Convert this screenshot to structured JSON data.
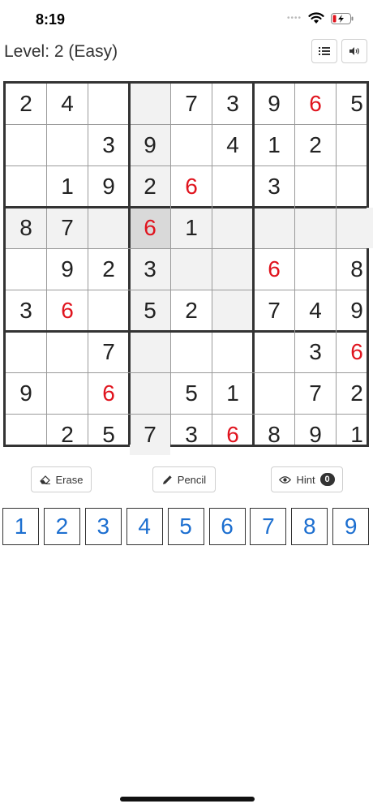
{
  "status_bar": {
    "time": "8:19"
  },
  "header": {
    "level_text": "Level: 2 (Easy)"
  },
  "board": {
    "rows": [
      [
        "2",
        "4",
        "",
        "",
        "7",
        "3",
        "9",
        "6",
        "5"
      ],
      [
        "",
        "",
        "3",
        "9",
        "",
        "4",
        "1",
        "2",
        ""
      ],
      [
        "",
        "1",
        "9",
        "2",
        "6",
        "",
        "3",
        "",
        ""
      ],
      [
        "8",
        "7",
        "",
        "6",
        "1",
        "",
        "",
        "",
        ""
      ],
      [
        "",
        "9",
        "2",
        "3",
        "",
        "",
        "6",
        "",
        "8"
      ],
      [
        "3",
        "6",
        "",
        "5",
        "2",
        "",
        "7",
        "4",
        "9"
      ],
      [
        "",
        "",
        "7",
        "",
        "",
        "",
        "",
        "3",
        "6"
      ],
      [
        "9",
        "",
        "6",
        "",
        "5",
        "1",
        "",
        "7",
        "2"
      ],
      [
        "",
        "2",
        "5",
        "7",
        "3",
        "6",
        "8",
        "9",
        "1"
      ]
    ],
    "selected": {
      "row": 3,
      "col": 3
    },
    "highlighted_cells": [
      [
        0,
        3
      ],
      [
        1,
        3
      ],
      [
        2,
        3
      ],
      [
        4,
        3
      ],
      [
        5,
        3
      ],
      [
        6,
        3
      ],
      [
        7,
        3
      ],
      [
        8,
        3
      ],
      [
        3,
        0
      ],
      [
        3,
        1
      ],
      [
        3,
        2
      ],
      [
        3,
        4
      ],
      [
        3,
        5
      ],
      [
        3,
        6
      ],
      [
        3,
        7
      ],
      [
        3,
        8
      ],
      [
        4,
        4
      ],
      [
        4,
        5
      ],
      [
        5,
        5
      ]
    ],
    "red_cells": [
      [
        0,
        7
      ],
      [
        2,
        4
      ],
      [
        3,
        3
      ],
      [
        4,
        6
      ],
      [
        5,
        1
      ],
      [
        6,
        8
      ],
      [
        7,
        2
      ],
      [
        8,
        5
      ]
    ],
    "number_color": "#222222",
    "red_color": "#e0141e",
    "highlight_color": "#f2f2f2",
    "selected_color": "#d9d9d9"
  },
  "actions": {
    "erase_label": "Erase",
    "pencil_label": "Pencil",
    "hint_label": "Hint",
    "hint_count": "0"
  },
  "number_pad": [
    "1",
    "2",
    "3",
    "4",
    "5",
    "6",
    "7",
    "8",
    "9"
  ],
  "number_pad_color": "#1d6fd0",
  "icons": {
    "wifi": "wifi-icon",
    "battery": "battery-charging-icon",
    "list": "list-icon",
    "sound": "volume-icon",
    "erase": "eraser-icon",
    "pencil": "pencil-icon",
    "hint": "eye-icon"
  }
}
